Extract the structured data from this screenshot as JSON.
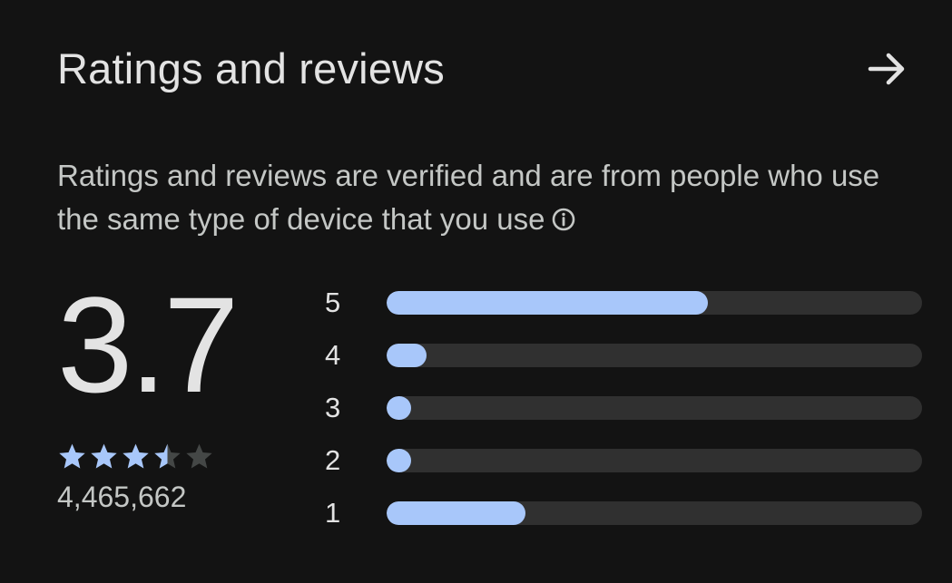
{
  "header": {
    "title": "Ratings and reviews",
    "arrow_icon": "arrow-right-icon"
  },
  "description": {
    "text": "Ratings and reviews are verified and are from people who use the same type of device that you use",
    "info_icon": "info-icon"
  },
  "summary": {
    "average": "3.7",
    "stars": 3.5,
    "count": "4,465,662"
  },
  "distribution": [
    {
      "label": "5",
      "fraction": 0.6
    },
    {
      "label": "4",
      "fraction": 0.075
    },
    {
      "label": "3",
      "fraction": 0.045
    },
    {
      "label": "2",
      "fraction": 0.045
    },
    {
      "label": "1",
      "fraction": 0.26
    }
  ],
  "colors": {
    "background": "#131313",
    "accent": "#a8c7fa",
    "track": "#303030",
    "empty_star": "#444746"
  }
}
